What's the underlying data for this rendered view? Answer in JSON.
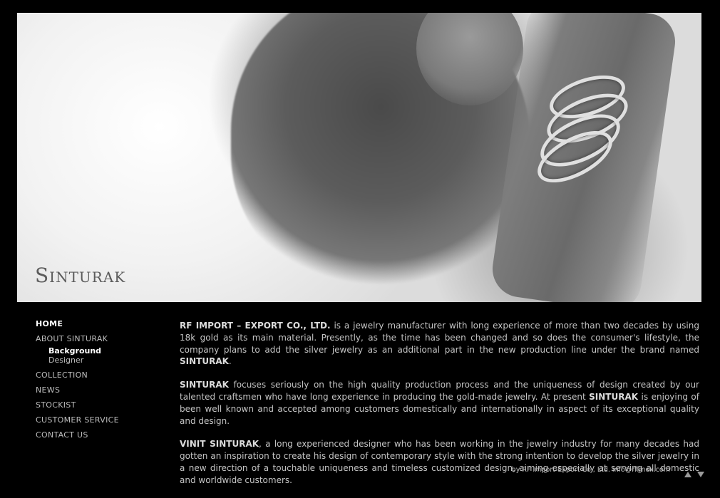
{
  "logo": {
    "text": "Sinturak"
  },
  "nav": {
    "items": [
      {
        "label": "HOME"
      },
      {
        "label": "ABOUT SINTURAK"
      },
      {
        "label": "COLLECTION"
      },
      {
        "label": "NEWS"
      },
      {
        "label": "STOCKIST"
      },
      {
        "label": "CUSTOMER SERVICE"
      },
      {
        "label": "CONTACT US"
      }
    ],
    "sub_items": [
      {
        "label": "Background"
      },
      {
        "label": "Designer"
      }
    ]
  },
  "content": {
    "p1": {
      "company": "RF IMPORT – EXPORT CO., LTD.",
      "text1": " is a jewelry manufacturer with long experience of more than two decades by using 18k gold as its main material. Presently, as the time has been changed and so does the consumer's lifestyle, the company plans to add the silver jewelry as an additional part in the new production line under the brand named ",
      "brand": "SINTURAK",
      "text2": "."
    },
    "p2": {
      "brand1": "SINTURAK",
      "text1": " focuses seriously on the high quality production process and the uniqueness of design created by our talented craftsmen who have long experience in producing the gold-made jewelry. At present ",
      "brand2": "SINTURAK",
      "text2": " is enjoying of been well known and accepted among customers domestically and internationally in aspect of its exceptional quality and design."
    },
    "p3": {
      "designer": "VINIT SINTURAK",
      "text": ", a long experienced designer who has been working in the jewelry industry for many decades had gotten an inspiration to create his design of contemporary style with the strong intention to develop the silver jewelry in a new direction of a touchable uniqueness and timeless customized design, aiming especially at serving all domestic and worldwide customers."
    }
  },
  "footer": {
    "credit": "by RF Import-Export Co., Ltd. info@rfimex.com"
  },
  "icons": {
    "scroll_up": "triangle-up-icon",
    "scroll_down": "triangle-down-icon"
  }
}
